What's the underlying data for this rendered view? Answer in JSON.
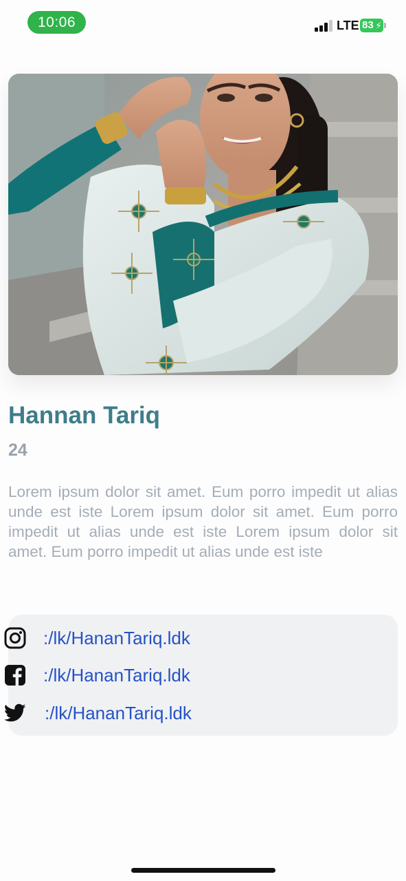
{
  "status_bar": {
    "time": "10:06",
    "network": "LTE",
    "battery_level": "83",
    "battery_color": "#34c759",
    "time_pill_color": "#2fb34a"
  },
  "profile": {
    "photo_icon": "profile-photo",
    "name": "Hannan Tariq",
    "age": "24",
    "bio": "Lorem ipsum dolor sit amet. Eum porro impedit ut alias unde est iste Lorem ipsum dolor sit amet. Eum porro impedit ut alias unde est iste Lorem ipsum dolor sit amet. Eum porro impedit ut alias unde est iste",
    "name_color": "#3e7d89"
  },
  "social": {
    "links": [
      {
        "icon": "instagram-icon",
        "text": ":/lk/HananTariq.ldk"
      },
      {
        "icon": "facebook-icon",
        "text": ":/lk/HananTariq.ldk"
      },
      {
        "icon": "twitter-icon",
        "text": ":/lk/HananTariq.ldk"
      }
    ],
    "link_color": "#2452c7"
  }
}
